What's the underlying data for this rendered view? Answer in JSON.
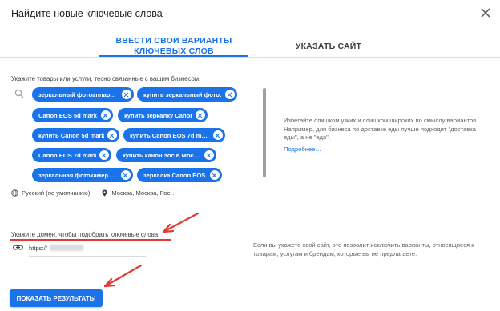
{
  "dialog": {
    "title": "Найдите новые ключевые слова",
    "close_icon": "close-icon"
  },
  "tabs": [
    {
      "label": "Ввести свои варианты ключевых слов",
      "active": true
    },
    {
      "label": "Указать сайт",
      "active": false
    }
  ],
  "keywords": {
    "instruction": "Укажите товары или услуги, тесно связанные с вашим бизнесом.",
    "search_icon": "search-icon",
    "chips": [
      "зеркальный фотоаппар…",
      "купить зеркальный фото…",
      "Canon EOS 5d mark",
      "купить зеркалку Canon",
      "купить Canon 5d mark",
      "купить Canon EOS 7d m…",
      "Canon EOS 7d mark",
      "купить канон эос в Мос…",
      "зеркальная фотокамер…",
      "зеркалка Canon EOS"
    ],
    "chip_remove_icon": "close-circle-icon",
    "hint": "Избегайте слишком узких и слишком широких по смыслу вариантов. Например, для бизнеса по доставке еды лучше подходит \"доставка еды\", а не \"еда\".",
    "hint_link": "Подробнее…",
    "language": "Русский (по умолчанию)",
    "location": "Москва, Москва, Рос…"
  },
  "domain": {
    "label": "Укажите домен, чтобы подобрать ключевые слова.",
    "url_prefix": "https://",
    "link_icon": "link-icon",
    "hint": "Если вы укажете свой сайт, это позволит исключить варианты, относящиеся к товарам, услугам и брендам, которые вы не предлагаете."
  },
  "actions": {
    "submit_label": "Показать результаты"
  },
  "colors": {
    "accent": "#1a73e8",
    "annotation": "#e53935"
  }
}
